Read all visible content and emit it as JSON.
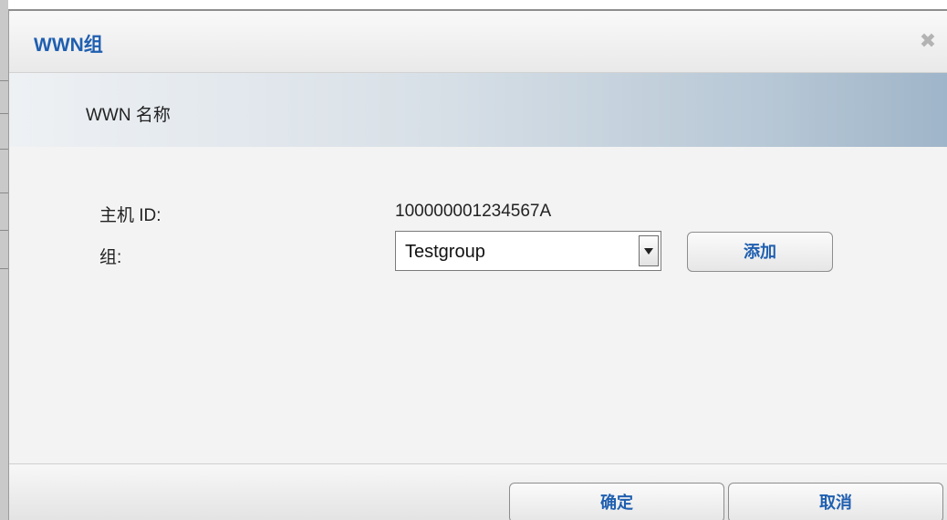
{
  "dialog": {
    "title": "WWN组",
    "close_icon": "close-icon",
    "close_glyph": "✖"
  },
  "section": {
    "title": "WWN 名称"
  },
  "form": {
    "host_id_label": "主机 ID:",
    "host_id_value": "100000001234567A",
    "group_label": "组:",
    "group_selected": "Testgroup",
    "add_label": "添加"
  },
  "footer": {
    "ok_label": "确定",
    "cancel_label": "取消"
  },
  "colors": {
    "accent": "#1f5fb0",
    "header_gradient_end": "#9fb5c9"
  }
}
